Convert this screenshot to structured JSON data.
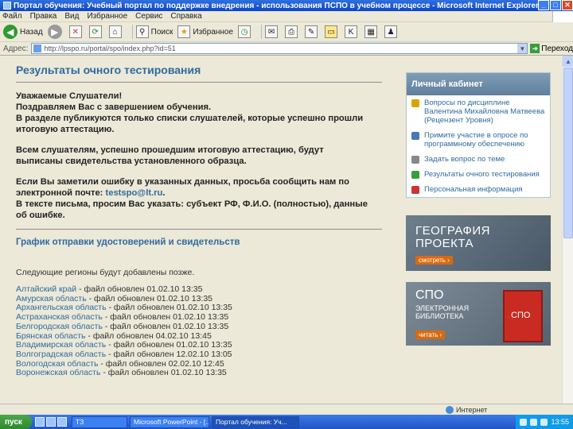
{
  "window": {
    "title": "Портал обучения: Учебный портал по поддержке внедрения - использования ПСПО в учебном процессе - Microsoft Internet Explorer"
  },
  "menu": [
    "Файл",
    "Правка",
    "Вид",
    "Избранное",
    "Сервис",
    "Справка"
  ],
  "toolbar": {
    "back_label": "Назад",
    "search_label": "Поиск",
    "favorites_label": "Избранное"
  },
  "address": {
    "label": "Адрес:",
    "url": "http://lpspo.ru/portal/spo/index.php?id=51",
    "go_label": "Переход"
  },
  "page": {
    "heading": "Результаты очного тестирования",
    "greeting": "Уважаемые Слушатели!",
    "congrats": "Поздравляем Вас с завершением обучения.",
    "info_line1": "В разделе публикуются только списки слушателей, которые успешно прошли",
    "info_line2": "итоговую аттестацию.",
    "cert_line1": "Всем слушателям, успешно прошедшим итоговую аттестацию, будут",
    "cert_line2": "выписаны свидетельства установленного образца.",
    "error_line1": "Если Вы заметили ошибку в указанных данных, просьба сообщить нам по",
    "error_prefix": "электронной почте: ",
    "email": "testspo@lt.ru",
    "error_line3": "В тексте письма, просим Вас указать: субъект РФ, Ф.И.О. (полностью), данные",
    "error_line4": "об ошибке.",
    "schedule_heading": "График отправки удостоверений и свидетельств",
    "notice": "Следующие регионы будут добавлены позже.",
    "regions": [
      {
        "name": "Алтайский край",
        "rest": " - файл обновлен 01.02.10 13:35"
      },
      {
        "name": "Амурская область",
        "rest": " - файл обновлен 01.02.10 13:35"
      },
      {
        "name": "Архангельская область",
        "rest": " - файл обновлен 01.02.10 13:35"
      },
      {
        "name": "Астраханская область",
        "rest": " - файл обновлен 01.02.10 13:35"
      },
      {
        "name": "Белгородская область",
        "rest": " - файл обновлен 01.02.10 13:35"
      },
      {
        "name": "Брянская область",
        "rest": " - файл обновлен 04.02.10 13:45"
      },
      {
        "name": "Владимирская область",
        "rest": " - файл обновлен 01.02.10 13:35"
      },
      {
        "name": "Волгоградская область",
        "rest": " - файл обновлен 12.02.10 13:05"
      },
      {
        "name": "Вологодская область",
        "rest": " - файл обновлен 02.02.10 12:45"
      },
      {
        "name": "Воронежская область",
        "rest": " - файл обновлен 01.02.10 13:35"
      }
    ]
  },
  "sidebar": {
    "cabinet_title": "Личный кабинет",
    "items": [
      {
        "label": "Вопросы по дисциплине Валентина Михайловна Матвеева (Рецензент Уровня)",
        "icon": "user-icon"
      },
      {
        "label": "Примите участие в опросе по программному обеспечению",
        "icon": "poll-icon"
      },
      {
        "label": "Задать вопрос по теме",
        "icon": "question-icon"
      },
      {
        "label": "Результаты очного тестирования",
        "icon": "results-icon"
      },
      {
        "label": "Персональная информация",
        "icon": "profile-icon"
      }
    ],
    "banner1_title_line1": "ГЕОГРАФИЯ",
    "banner1_title_line2": "ПРОЕКТА",
    "banner1_button": "смотреть ›",
    "banner2_title": "СПО",
    "banner2_sub1": "ЭЛЕКТРОННАЯ",
    "banner2_sub2": "БИБЛИОТЕКА",
    "banner2_button": "читать ›",
    "book_label": "СПО"
  },
  "status": {
    "text": "",
    "zone": "Интернет"
  },
  "taskbar": {
    "start_label": "пуск",
    "tasks": [
      "ТЗ",
      "Microsoft PowerPoint - [...]",
      "Портал обучения: Уч..."
    ],
    "clock": "13:55"
  }
}
